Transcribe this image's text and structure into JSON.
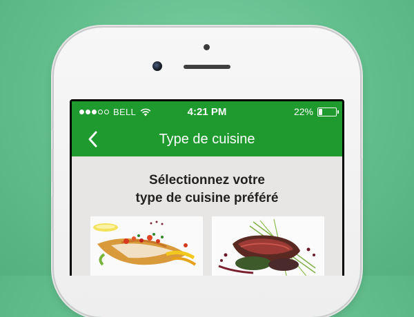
{
  "status_bar": {
    "signal_dots": [
      true,
      true,
      true,
      false,
      false
    ],
    "carrier": "BELL",
    "time": "4:21 PM",
    "battery_percent": "22%",
    "battery_level": 0.22,
    "wifi_icon": "wifi-icon"
  },
  "nav": {
    "back_icon": "chevron-left-icon",
    "title": "Type de cuisine"
  },
  "main": {
    "heading_line1": "Sélectionnez votre",
    "heading_line2": "type de cuisine préféré",
    "cards": [
      {
        "image": "fish-dish-photo"
      },
      {
        "image": "steak-dish-photo"
      }
    ]
  },
  "colors": {
    "accent_green": "#1f9a2e",
    "background_green": "#62be8d",
    "content_bg": "#e8e6e4"
  }
}
